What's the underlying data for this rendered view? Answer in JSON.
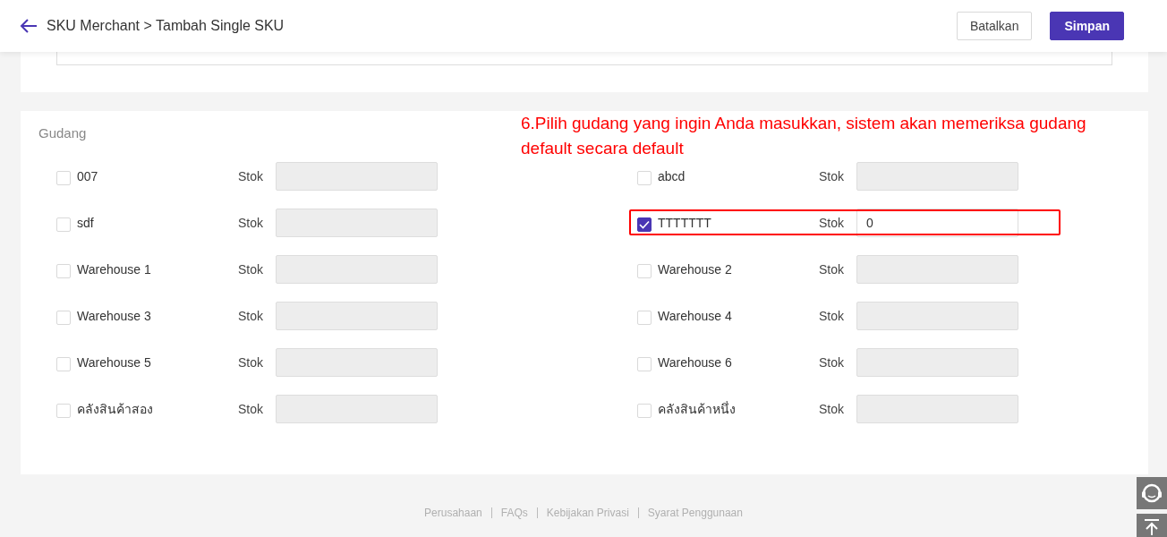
{
  "header": {
    "breadcrumb": "SKU Merchant > Tambah Single SKU",
    "buttons": [
      {
        "label": "Batalkan",
        "kind": "secondary"
      },
      {
        "label": "Simpan",
        "kind": "primary"
      }
    ]
  },
  "warehouse_section": {
    "title": "Gudang",
    "annotation": "6.Pilih gudang yang ingin Anda masukkan, sistem akan memeriksa gudang default secara default",
    "warehouses": [
      {
        "name": "007",
        "checked": false,
        "stock_label": "Stok"
      },
      {
        "name": "abcd",
        "checked": false,
        "stock_label": "Stok"
      },
      {
        "name": "sdf",
        "checked": false,
        "stock_label": "Stok"
      },
      {
        "name": "TTTTTTT",
        "checked": true,
        "stock_label": "Stok",
        "stock": "0",
        "highlighted": true
      },
      {
        "name": "Warehouse 1",
        "checked": false,
        "stock_label": "Stok"
      },
      {
        "name": "Warehouse 2",
        "checked": false,
        "stock_label": "Stok"
      },
      {
        "name": "Warehouse 3",
        "checked": false,
        "stock_label": "Stok"
      },
      {
        "name": "Warehouse 4",
        "checked": false,
        "stock_label": "Stok"
      },
      {
        "name": "Warehouse 5",
        "checked": false,
        "stock_label": "Stok"
      },
      {
        "name": "Warehouse 6",
        "checked": false,
        "stock_label": "Stok"
      },
      {
        "name": "คลังสินค้าสอง",
        "checked": false,
        "stock_label": "Stok"
      },
      {
        "name": "คลังสินค้าหนึ่ง",
        "checked": false,
        "stock_label": "Stok"
      }
    ]
  },
  "footer": {
    "links": [
      "Perusahaan",
      "FAQs",
      "Kebijakan Privasi",
      "Syarat Penggunaan"
    ]
  }
}
